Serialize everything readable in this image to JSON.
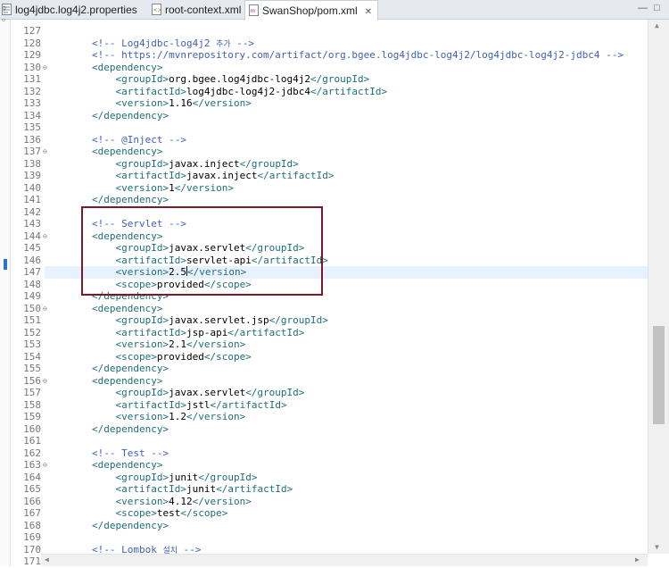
{
  "tabs": [
    {
      "label": "log4jdbc.log4j2.properties",
      "active": false
    },
    {
      "label": "root-context.xml",
      "active": false
    },
    {
      "label": "SwanShop/pom.xml",
      "active": true,
      "close": "✕"
    }
  ],
  "window_controls": {
    "minimize": "—",
    "maximize": "□"
  },
  "editor": {
    "first_line": 127,
    "current_line": 147,
    "fold_lines": [
      130,
      137,
      144,
      150,
      156,
      163
    ],
    "lines": [
      "",
      "        <!-- Log4jdbc-log4j2 추가 -->",
      "        <!-- https://mvnrepository.com/artifact/org.bgee.log4jdbc-log4j2/log4jdbc-log4j2-jdbc4 -->",
      "        <dependency>",
      "            <groupId>org.bgee.log4jdbc-log4j2</groupId>",
      "            <artifactId>log4jdbc-log4j2-jdbc4</artifactId>",
      "            <version>1.16</version>",
      "        </dependency>",
      "",
      "        <!-- @Inject -->",
      "        <dependency>",
      "            <groupId>javax.inject</groupId>",
      "            <artifactId>javax.inject</artifactId>",
      "            <version>1</version>",
      "        </dependency>",
      "",
      "        <!-- Servlet -->",
      "        <dependency>",
      "            <groupId>javax.servlet</groupId>",
      "            <artifactId>servlet-api</artifactId>",
      "            <version>2.5</version>",
      "            <scope>provided</scope>",
      "        </dependency>",
      "        <dependency>",
      "            <groupId>javax.servlet.jsp</groupId>",
      "            <artifactId>jsp-api</artifactId>",
      "            <version>2.1</version>",
      "            <scope>provided</scope>",
      "        </dependency>",
      "        <dependency>",
      "            <groupId>javax.servlet</groupId>",
      "            <artifactId>jstl</artifactId>",
      "            <version>1.2</version>",
      "        </dependency>",
      "",
      "        <!-- Test -->",
      "        <dependency>",
      "            <groupId>junit</groupId>",
      "            <artifactId>junit</artifactId>",
      "            <version>4.12</version>",
      "            <scope>test</scope>",
      "        </dependency>",
      "",
      "        <!-- Lombok 설치 -->",
      "        <!-- https://mvnrepository.com/artifact/org.projectlombok/lombok -->"
    ]
  },
  "colors": {
    "comment": "#3f5fbf",
    "tag": "#1f6f78",
    "text": "#000000",
    "highlight_box": "#7a1a24",
    "current_line": "#e8f2fe"
  }
}
